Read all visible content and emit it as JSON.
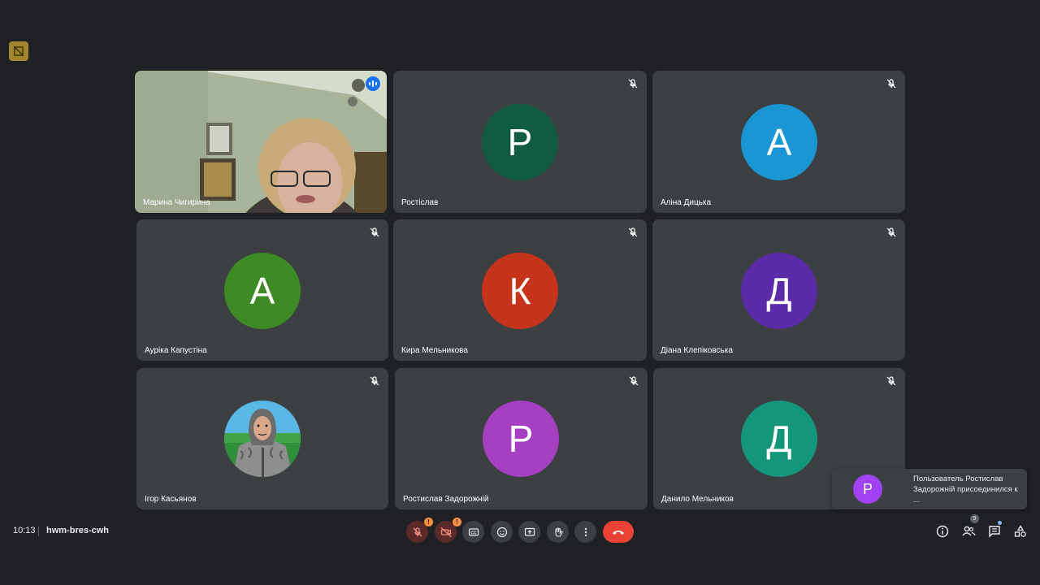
{
  "colors": {
    "background": "#202124",
    "tile": "#3c4043",
    "active_outline": "#1a73e8",
    "end_call": "#ea4335",
    "warning": "#fa903e"
  },
  "participants": [
    {
      "name": "Марина Чигирина",
      "type": "video",
      "speaking": true
    },
    {
      "name": "Ростіслав",
      "initial": "Р",
      "avatar_color": "#0f5c40",
      "muted": true
    },
    {
      "name": "Аліна Дицька",
      "initial": "А",
      "avatar_color": "#1a96d4",
      "muted": true
    },
    {
      "name": "Ауріка Капустіна",
      "initial": "А",
      "avatar_color": "#3e8a24",
      "muted": true
    },
    {
      "name": "Кира Мельникова",
      "initial": "К",
      "avatar_color": "#c5341b",
      "muted": true
    },
    {
      "name": "Діана Клепіковська",
      "initial": "Д",
      "avatar_color": "#5a2ca8",
      "muted": true
    },
    {
      "name": "Ігор Касьянов",
      "type": "photo",
      "muted": true
    },
    {
      "name": "Ростислав Задорожній",
      "initial": "Р",
      "avatar_color": "#a63fc1",
      "muted": true
    },
    {
      "name": "Данило Мельников",
      "initial": "Д",
      "avatar_color": "#14967a",
      "muted": true
    }
  ],
  "bottom_bar": {
    "time": "10:13",
    "meeting_code": "hwm-bres-cwh",
    "warning_mark": "!",
    "participant_count": "9",
    "icons": {
      "mic": "mic-off-icon",
      "camera": "camera-off-icon",
      "captions": "captions-icon",
      "reactions": "emoji-icon",
      "present": "present-screen-icon",
      "hand": "raise-hand-icon",
      "more": "more-vert-icon",
      "end": "end-call-icon",
      "info": "info-icon",
      "people": "people-icon",
      "chat": "chat-icon",
      "activities": "activities-icon"
    }
  },
  "notification": {
    "initial": "Р",
    "message": "Пользователь Ростислав Задорожній присоединился к ..."
  }
}
